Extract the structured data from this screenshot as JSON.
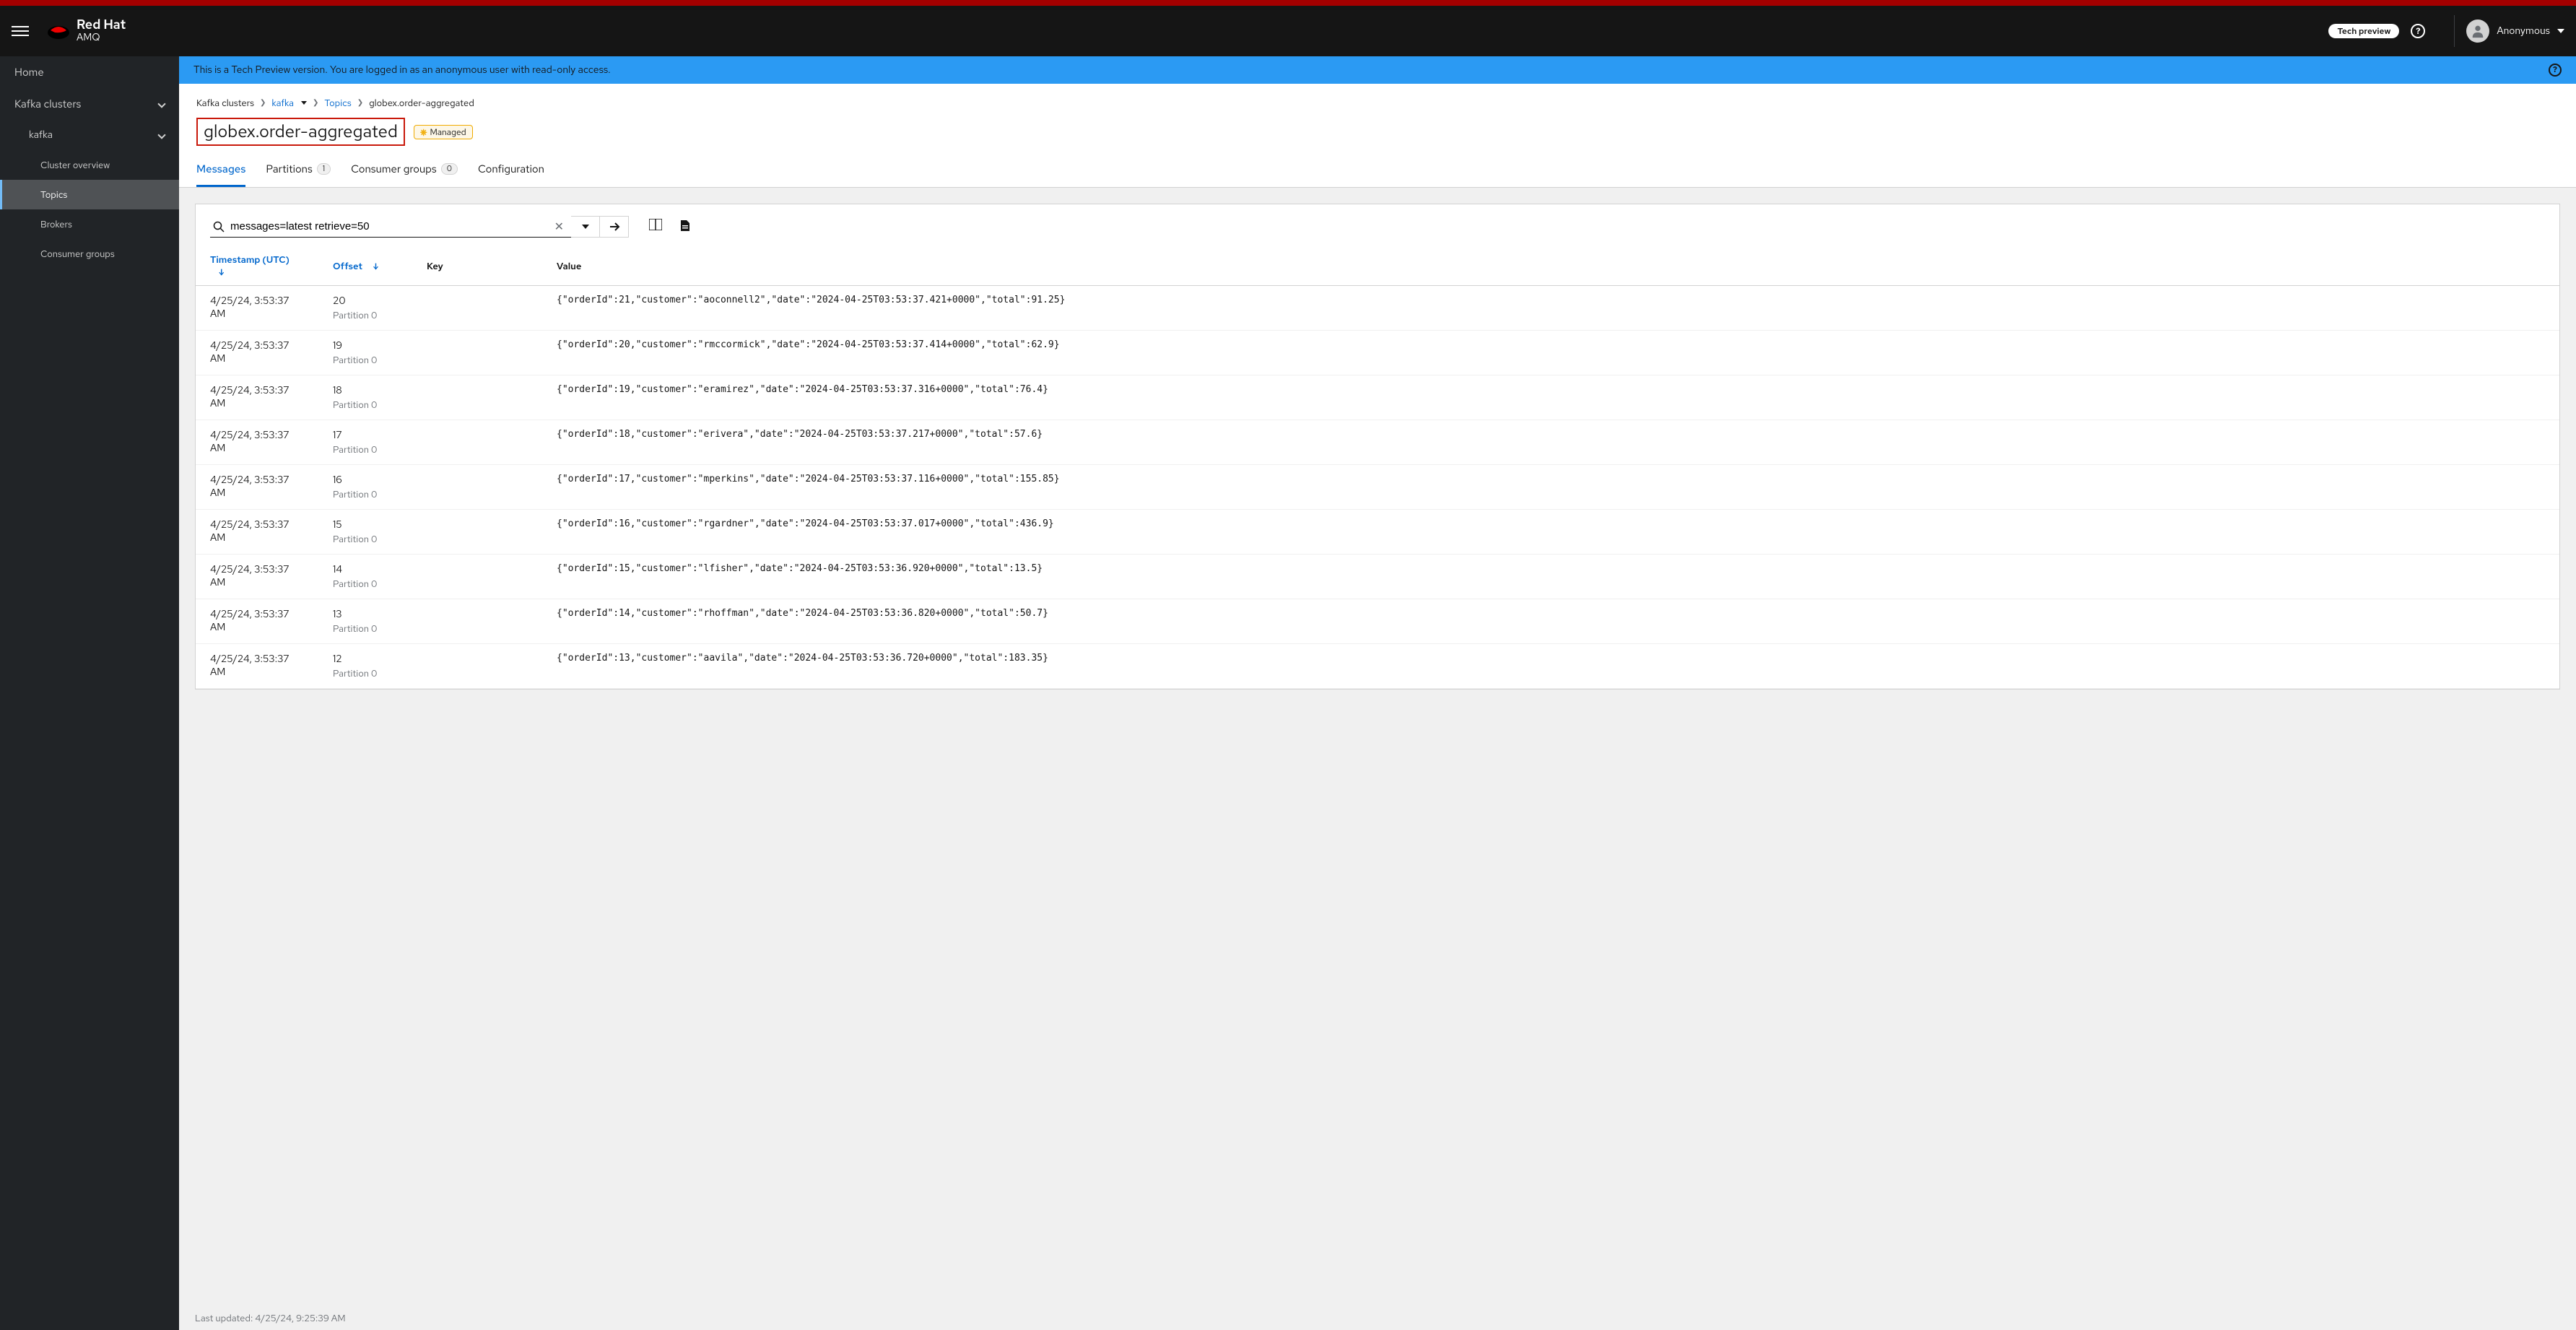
{
  "masthead": {
    "brand": "Red Hat",
    "product": "AMQ",
    "tech_preview_label": "Tech preview",
    "user_name": "Anonymous"
  },
  "sidebar": {
    "home": "Home",
    "kafka_clusters": "Kafka clusters",
    "cluster_name": "kafka",
    "items": [
      {
        "label": "Cluster overview"
      },
      {
        "label": "Topics"
      },
      {
        "label": "Brokers"
      },
      {
        "label": "Consumer groups"
      }
    ]
  },
  "banner": {
    "text": "This is a Tech Preview version. You are logged in as an anonymous user with read-only access."
  },
  "breadcrumb": {
    "root": "Kafka clusters",
    "cluster": "kafka",
    "section": "Topics",
    "current": "globex.order-aggregated"
  },
  "page": {
    "title": "globex.order-aggregated",
    "managed_label": "Managed"
  },
  "tabs": {
    "messages": "Messages",
    "partitions": "Partitions",
    "partitions_count": "1",
    "consumer_groups": "Consumer groups",
    "consumer_groups_count": "0",
    "configuration": "Configuration"
  },
  "search": {
    "value": "messages=latest retrieve=50"
  },
  "columns": {
    "timestamp": "Timestamp (UTC)",
    "offset": "Offset",
    "key": "Key",
    "value": "Value"
  },
  "rows": [
    {
      "ts": "4/25/24, 3:53:37 AM",
      "offset": "20",
      "partition": "Partition 0",
      "key": "",
      "value": "{\"orderId\":21,\"customer\":\"aoconnell2\",\"date\":\"2024-04-25T03:53:37.421+0000\",\"total\":91.25}"
    },
    {
      "ts": "4/25/24, 3:53:37 AM",
      "offset": "19",
      "partition": "Partition 0",
      "key": "",
      "value": "{\"orderId\":20,\"customer\":\"rmccormick\",\"date\":\"2024-04-25T03:53:37.414+0000\",\"total\":62.9}"
    },
    {
      "ts": "4/25/24, 3:53:37 AM",
      "offset": "18",
      "partition": "Partition 0",
      "key": "",
      "value": "{\"orderId\":19,\"customer\":\"eramirez\",\"date\":\"2024-04-25T03:53:37.316+0000\",\"total\":76.4}"
    },
    {
      "ts": "4/25/24, 3:53:37 AM",
      "offset": "17",
      "partition": "Partition 0",
      "key": "",
      "value": "{\"orderId\":18,\"customer\":\"erivera\",\"date\":\"2024-04-25T03:53:37.217+0000\",\"total\":57.6}"
    },
    {
      "ts": "4/25/24, 3:53:37 AM",
      "offset": "16",
      "partition": "Partition 0",
      "key": "",
      "value": "{\"orderId\":17,\"customer\":\"mperkins\",\"date\":\"2024-04-25T03:53:37.116+0000\",\"total\":155.85}"
    },
    {
      "ts": "4/25/24, 3:53:37 AM",
      "offset": "15",
      "partition": "Partition 0",
      "key": "",
      "value": "{\"orderId\":16,\"customer\":\"rgardner\",\"date\":\"2024-04-25T03:53:37.017+0000\",\"total\":436.9}"
    },
    {
      "ts": "4/25/24, 3:53:37 AM",
      "offset": "14",
      "partition": "Partition 0",
      "key": "",
      "value": "{\"orderId\":15,\"customer\":\"lfisher\",\"date\":\"2024-04-25T03:53:36.920+0000\",\"total\":13.5}"
    },
    {
      "ts": "4/25/24, 3:53:37 AM",
      "offset": "13",
      "partition": "Partition 0",
      "key": "",
      "value": "{\"orderId\":14,\"customer\":\"rhoffman\",\"date\":\"2024-04-25T03:53:36.820+0000\",\"total\":50.7}"
    },
    {
      "ts": "4/25/24, 3:53:37 AM",
      "offset": "12",
      "partition": "Partition 0",
      "key": "",
      "value": "{\"orderId\":13,\"customer\":\"aavila\",\"date\":\"2024-04-25T03:53:36.720+0000\",\"total\":183.35}"
    }
  ],
  "footer": {
    "last_updated": "Last updated: 4/25/24, 9:25:39 AM"
  }
}
